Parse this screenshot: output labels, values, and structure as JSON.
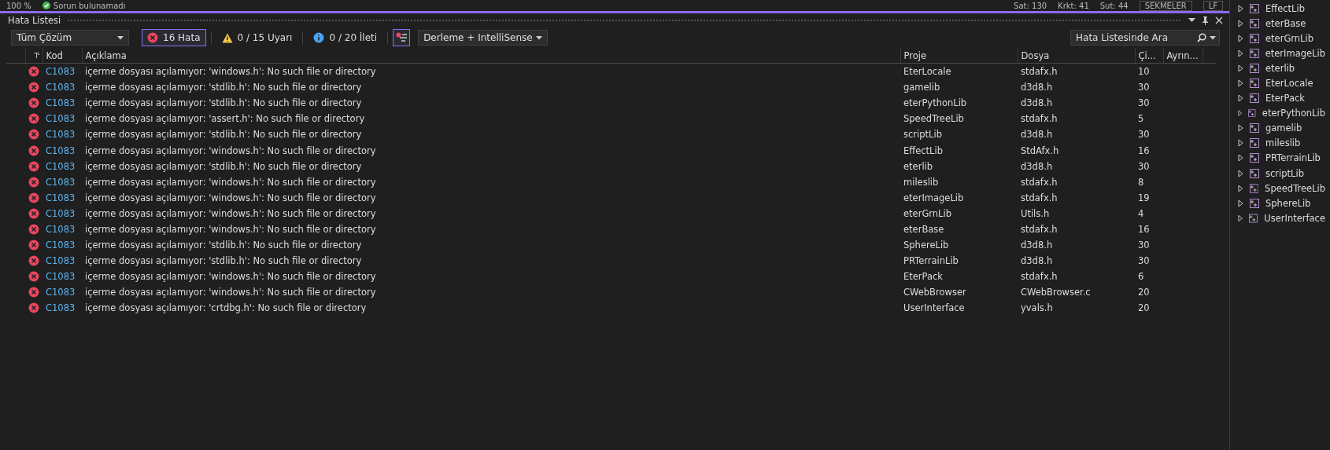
{
  "status_bar": {
    "zoom": "100 %",
    "status": "Sorun bulunamadı",
    "line": "Sat: 130",
    "char": "Krkt: 41",
    "column": "Sut: 44",
    "indent": "SEKMELER",
    "eol": "LF"
  },
  "error_list": {
    "title": "Hata Listesi",
    "scope": "Tüm Çözüm",
    "filters": [
      {
        "kind": "error",
        "label": "16 Hata",
        "selected": true
      },
      {
        "kind": "warning",
        "label": "0 / 15 Uyarı",
        "selected": false
      },
      {
        "kind": "info",
        "label": "0 / 20 İleti",
        "selected": false
      }
    ],
    "source": "Derleme + IntelliSense",
    "search": {
      "placeholder": "Hata Listesinde Ara"
    },
    "columns": [
      "Kod",
      "Açıklama",
      "Proje",
      "Dosya",
      "Çi...",
      "Ayrın..."
    ],
    "rows": [
      {
        "kind": "error",
        "code": "C1083",
        "description": "içerme dosyası açılamıyor: 'windows.h': No such file or directory",
        "project": "EterLocale",
        "file": "stdafx.h",
        "line": "10"
      },
      {
        "kind": "error",
        "code": "C1083",
        "description": "içerme dosyası açılamıyor: 'stdlib.h': No such file or directory",
        "project": "gamelib",
        "file": "d3d8.h",
        "line": "30"
      },
      {
        "kind": "error",
        "code": "C1083",
        "description": "içerme dosyası açılamıyor: 'stdlib.h': No such file or directory",
        "project": "eterPythonLib",
        "file": "d3d8.h",
        "line": "30"
      },
      {
        "kind": "error",
        "code": "C1083",
        "description": "içerme dosyası açılamıyor: 'assert.h': No such file or directory",
        "project": "SpeedTreeLib",
        "file": "stdafx.h",
        "line": "5"
      },
      {
        "kind": "error",
        "code": "C1083",
        "description": "içerme dosyası açılamıyor: 'stdlib.h': No such file or directory",
        "project": "scriptLib",
        "file": "d3d8.h",
        "line": "30"
      },
      {
        "kind": "error",
        "code": "C1083",
        "description": "içerme dosyası açılamıyor: 'windows.h': No such file or directory",
        "project": "EffectLib",
        "file": "StdAfx.h",
        "line": "16"
      },
      {
        "kind": "error",
        "code": "C1083",
        "description": "içerme dosyası açılamıyor: 'stdlib.h': No such file or directory",
        "project": "eterlib",
        "file": "d3d8.h",
        "line": "30"
      },
      {
        "kind": "error",
        "code": "C1083",
        "description": "içerme dosyası açılamıyor: 'windows.h': No such file or directory",
        "project": "mileslib",
        "file": "stdafx.h",
        "line": "8"
      },
      {
        "kind": "error",
        "code": "C1083",
        "description": "içerme dosyası açılamıyor: 'windows.h': No such file or directory",
        "project": "eterImageLib",
        "file": "stdafx.h",
        "line": "19"
      },
      {
        "kind": "error",
        "code": "C1083",
        "description": "içerme dosyası açılamıyor: 'windows.h': No such file or directory",
        "project": "eterGrnLib",
        "file": "Utils.h",
        "line": "4"
      },
      {
        "kind": "error",
        "code": "C1083",
        "description": "içerme dosyası açılamıyor: 'windows.h': No such file or directory",
        "project": "eterBase",
        "file": "stdafx.h",
        "line": "16"
      },
      {
        "kind": "error",
        "code": "C1083",
        "description": "içerme dosyası açılamıyor: 'stdlib.h': No such file or directory",
        "project": "SphereLib",
        "file": "d3d8.h",
        "line": "30"
      },
      {
        "kind": "error",
        "code": "C1083",
        "description": "içerme dosyası açılamıyor: 'stdlib.h': No such file or directory",
        "project": "PRTerrainLib",
        "file": "d3d8.h",
        "line": "30"
      },
      {
        "kind": "error",
        "code": "C1083",
        "description": "içerme dosyası açılamıyor: 'windows.h': No such file or directory",
        "project": "EterPack",
        "file": "stdafx.h",
        "line": "6"
      },
      {
        "kind": "error",
        "code": "C1083",
        "description": "içerme dosyası açılamıyor: 'windows.h': No such file or directory",
        "project": "CWebBrowser",
        "file": "CWebBrowser.c",
        "line": "20"
      },
      {
        "kind": "error",
        "code": "C1083",
        "description": "içerme dosyası açılamıyor: 'crtdbg.h': No such file or directory",
        "project": "UserInterface",
        "file": "yvals.h",
        "line": "20"
      }
    ]
  },
  "solution_tree": {
    "items": [
      {
        "label": "EffectLib",
        "expanded": false
      },
      {
        "label": "eterBase",
        "expanded": false
      },
      {
        "label": "eterGrnLib",
        "expanded": false
      },
      {
        "label": "eterImageLib",
        "expanded": false
      },
      {
        "label": "eterlib",
        "expanded": false
      },
      {
        "label": "EterLocale",
        "expanded": false
      },
      {
        "label": "EterPack",
        "expanded": false
      },
      {
        "label": "eterPythonLib",
        "expanded": false
      },
      {
        "label": "gamelib",
        "expanded": false
      },
      {
        "label": "mileslib",
        "expanded": false
      },
      {
        "label": "PRTerrainLib",
        "expanded": false
      },
      {
        "label": "scriptLib",
        "expanded": false
      },
      {
        "label": "SpeedTreeLib",
        "expanded": false
      },
      {
        "label": "SphereLib",
        "expanded": false
      },
      {
        "label": "UserInterface",
        "expanded": false
      }
    ]
  }
}
